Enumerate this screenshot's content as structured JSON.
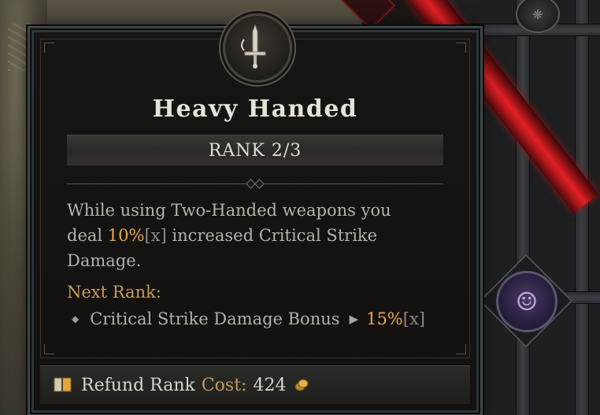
{
  "tooltip": {
    "title": "Heavy Handed",
    "rank": "RANK 2/3",
    "description": {
      "line1": "While using Two-Handed weapons you",
      "line2_pre": "deal ",
      "line2_value": "10%",
      "line2_bracket": "[x]",
      "line2_post": " increased Critical Strike",
      "line3": "Damage."
    },
    "next_rank": {
      "label": "Next Rank:",
      "stat": "Critical Strike Damage Bonus",
      "value": "15%",
      "bracket": "[x]"
    },
    "footer": {
      "action": "Refund Rank",
      "cost_label": "Cost:",
      "cost_value": "424"
    }
  },
  "icons": {
    "medallion": "sword-icon",
    "footer_action": "book-icon",
    "currency": "gold-coin-icon",
    "skill_node": "demon-face-icon"
  },
  "colors": {
    "value_highlight": "#e8a94a",
    "label_gold": "#c49a5a",
    "text_body": "#b6b1a7",
    "title": "#e7e2d7",
    "red_path": "#e02126"
  }
}
